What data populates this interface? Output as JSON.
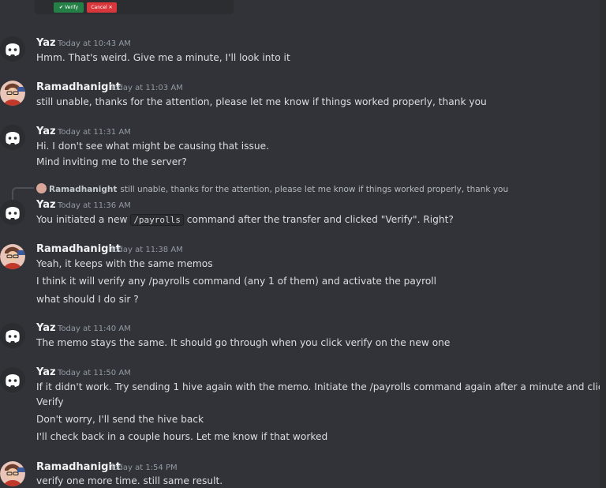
{
  "embed": {
    "verify_label": "Verify",
    "cancel_label": "Cancel",
    "verify_icon": "check-icon",
    "cancel_icon": "close-icon"
  },
  "messages": [
    {
      "author": "Yaz",
      "avatar": "discord-default-avatar",
      "time": "Today at 10:43 AM",
      "lines": [
        "Hmm. That's weird. Give me a minute, I'll look into it"
      ]
    },
    {
      "author": "Ramadhanight",
      "avatar": "user-avatar",
      "time": "Today at 11:03 AM",
      "lines": [
        "still unable, thanks for the attention, please let me know if things worked properly, thank you"
      ]
    },
    {
      "author": "Yaz",
      "avatar": "discord-default-avatar",
      "time": "Today at 11:31 AM",
      "lines": [
        "Hi. I don't see what might be causing that issue.",
        "Mind inviting me to the server?"
      ]
    },
    {
      "author": "Yaz",
      "avatar": "discord-default-avatar",
      "time": "Today at 11:36 AM",
      "reply_to": {
        "author": "Ramadhanight",
        "text": "still unable, thanks for the attention, please let me know if things worked properly, thank you"
      },
      "lines_parts": {
        "before": "You initiated a new ",
        "code": "/payrolls",
        "after": " command after the transfer and clicked \"Verify\". Right?"
      }
    },
    {
      "author": "Ramadhanight",
      "avatar": "user-avatar",
      "time": "Today at 11:38 AM",
      "lines": [
        "Yeah,  it keeps with the same memos",
        "I think it will verify any /payrolls command (any 1 of them) and activate the payroll",
        "what should I do sir ?"
      ]
    },
    {
      "author": "Yaz",
      "avatar": "discord-default-avatar",
      "time": "Today at 11:40 AM",
      "lines": [
        "The memo stays the same. It should go through when you click verify on the new one"
      ]
    },
    {
      "author": "Yaz",
      "avatar": "discord-default-avatar",
      "time": "Today at 11:50 AM",
      "lines": [
        "If it didn't work. Try sending 1 hive again with the memo. Initiate the /payrolls command again after a minute and click",
        "Verify",
        "Don't worry, I'll send the hive back",
        "I'll check back in a couple hours. Let me know if that worked"
      ]
    },
    {
      "author": "Ramadhanight",
      "avatar": "user-avatar",
      "time": "Today at 1:54 PM",
      "lines": [
        "verify one more time. still same result."
      ]
    }
  ]
}
